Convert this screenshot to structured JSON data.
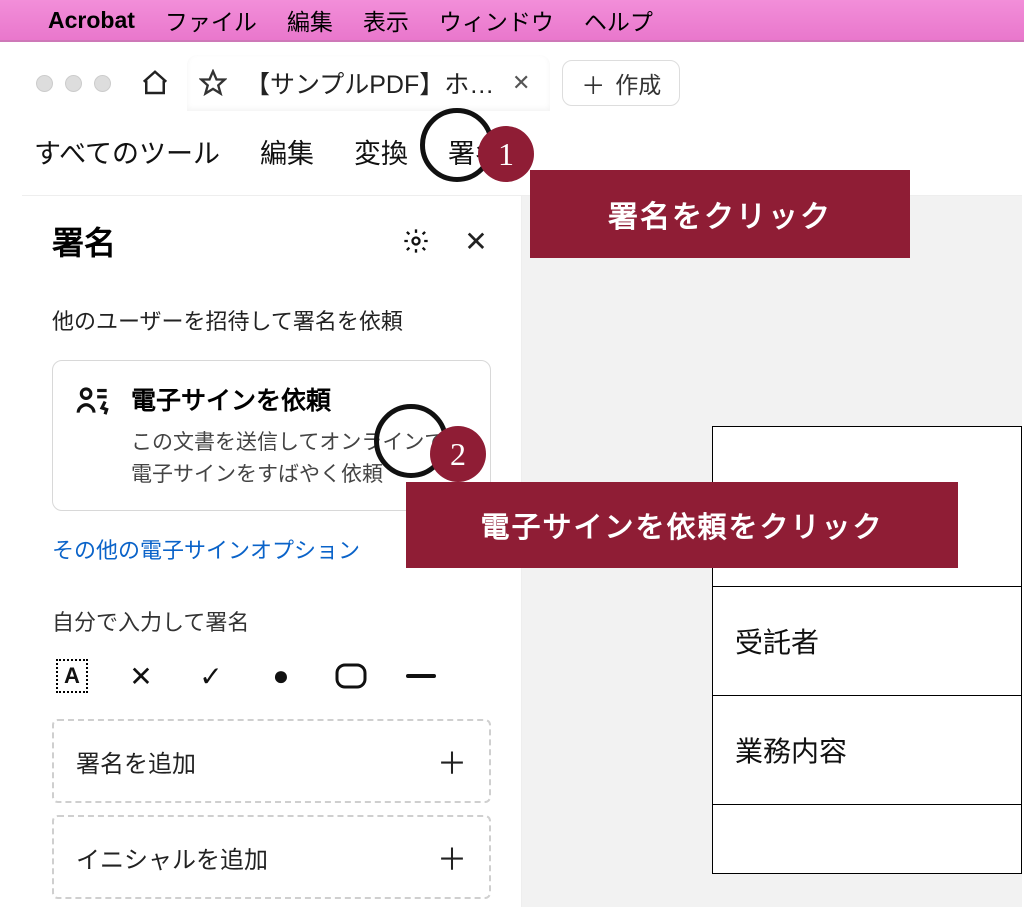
{
  "menubar": {
    "app": "Acrobat",
    "items": [
      "ファイル",
      "編集",
      "表示",
      "ウィンドウ",
      "ヘルプ"
    ]
  },
  "tabs": {
    "active_title": "【サンプルPDF】ホ…",
    "new_label": "作成"
  },
  "toolbar": {
    "all_tools": "すべてのツール",
    "edit": "編集",
    "convert": "変換",
    "sign": "署名"
  },
  "sidebar": {
    "title": "署名",
    "invite_label": "他のユーザーを招待して署名を依頼",
    "card": {
      "title": "電子サインを依頼",
      "desc_line1": "この文書を送信してオンラインで",
      "desc_line2": "電子サインをすばやく依頼"
    },
    "more_link": "その他の電子サインオプション",
    "self_sign_label": "自分で入力して署名",
    "add_signature": "署名を追加",
    "add_initials": "イニシャルを追加",
    "tool_text_A": "A"
  },
  "document": {
    "row1": "受託者",
    "row2": "業務内容"
  },
  "callouts": {
    "step1_num": "1",
    "step1_text": "署名をクリック",
    "step2_num": "2",
    "step2_text": "電子サインを依頼をクリック"
  }
}
